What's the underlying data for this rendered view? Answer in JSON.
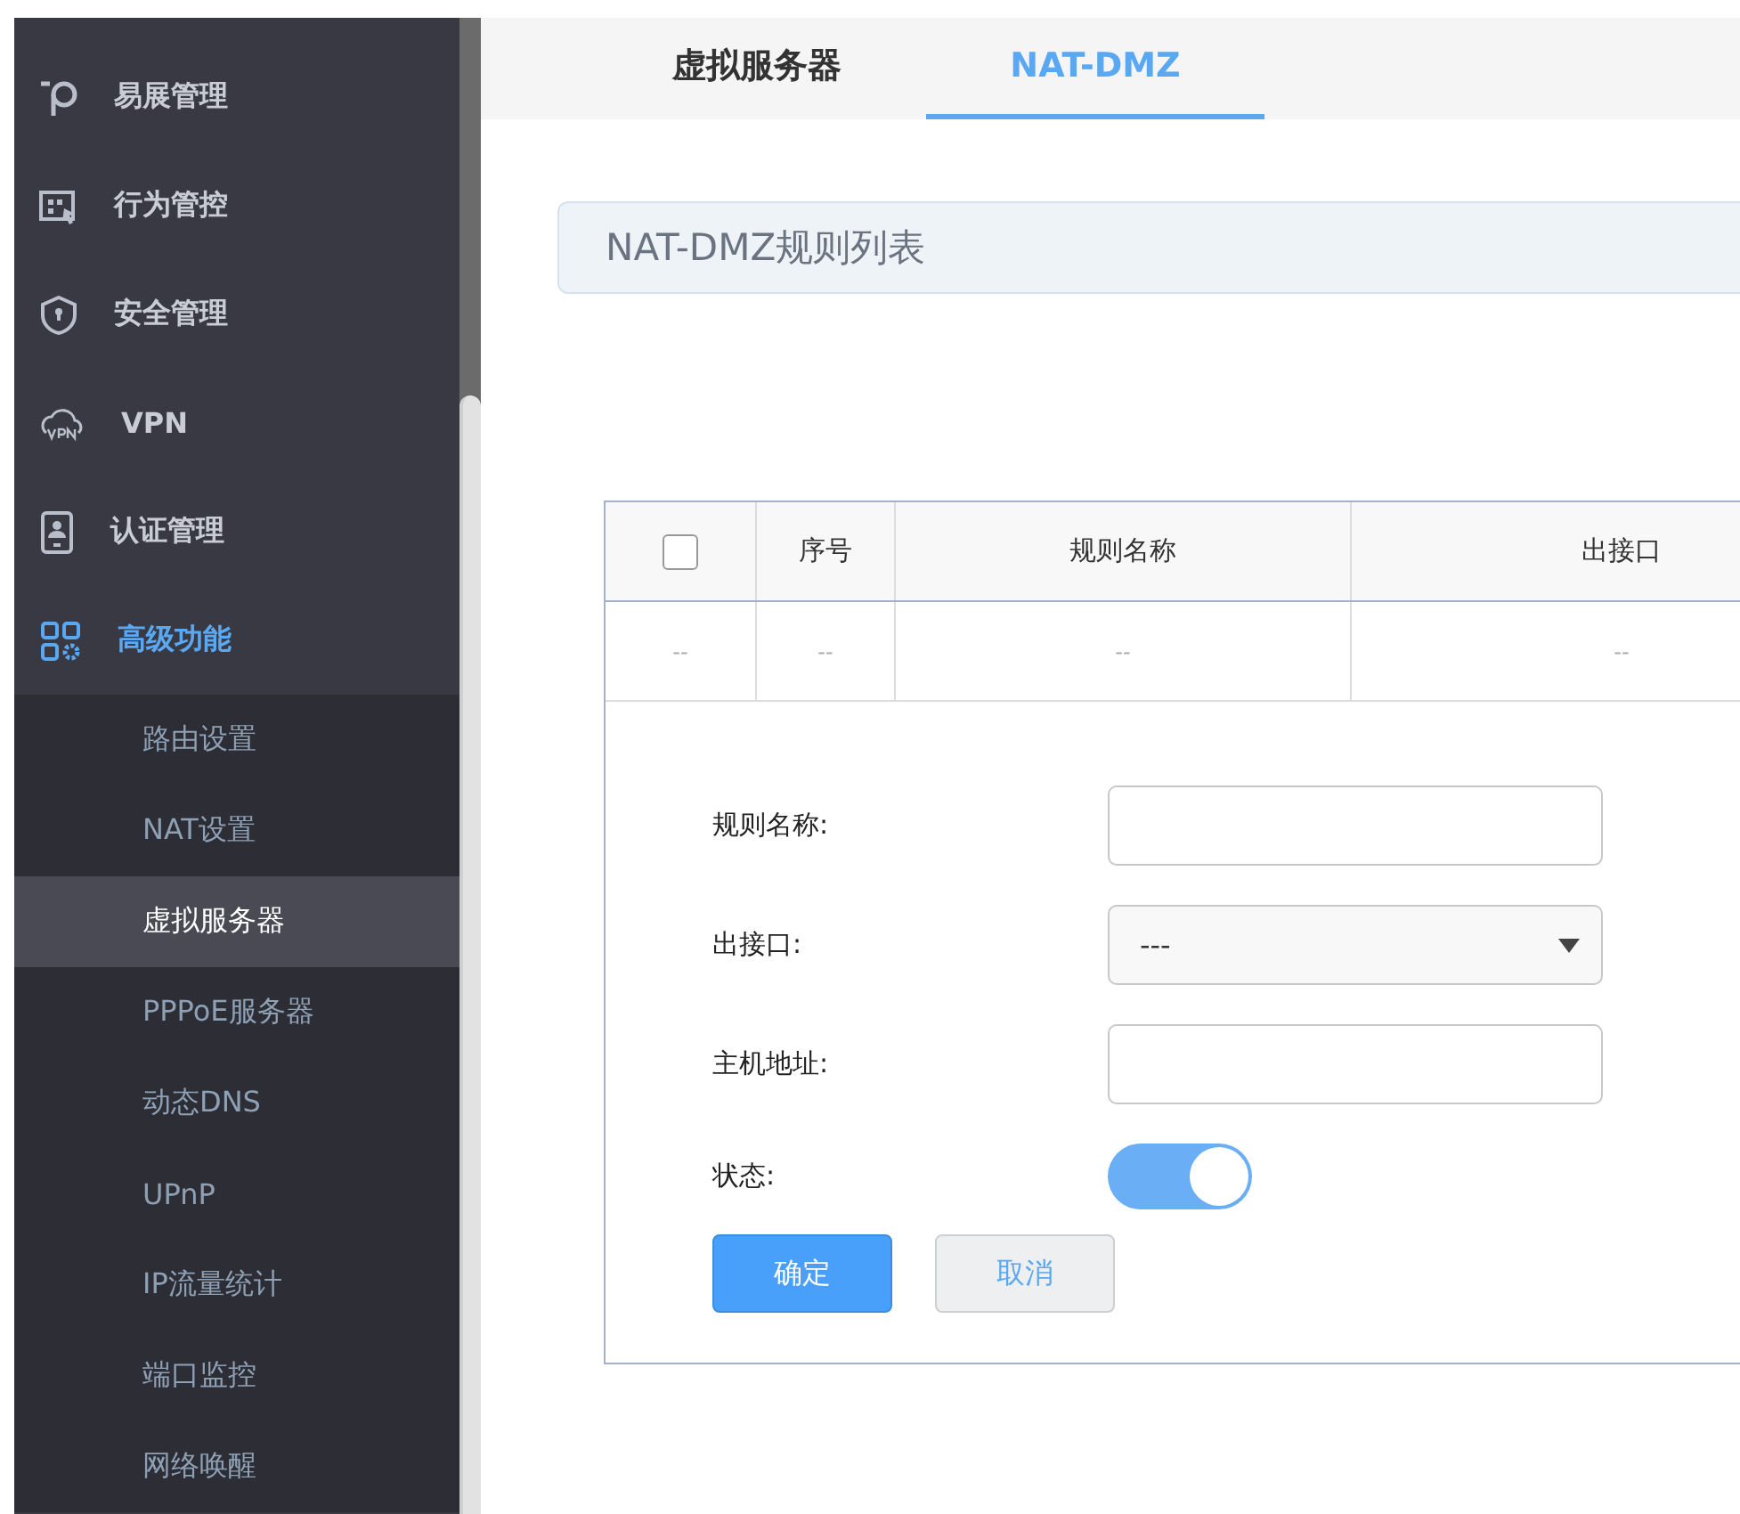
{
  "sidebar": {
    "items": [
      {
        "label": "易展管理",
        "selected": false
      },
      {
        "label": "行为管控",
        "selected": false
      },
      {
        "label": "安全管理",
        "selected": false
      },
      {
        "label": "VPN",
        "selected": false
      },
      {
        "label": "认证管理",
        "selected": false
      },
      {
        "label": "高级功能",
        "selected": true,
        "expanded": true,
        "children": [
          {
            "label": "路由设置",
            "selected": false
          },
          {
            "label": "NAT设置",
            "selected": false
          },
          {
            "label": "虚拟服务器",
            "selected": true
          },
          {
            "label": "PPPoE服务器",
            "selected": false
          },
          {
            "label": "动态DNS",
            "selected": false
          },
          {
            "label": "UPnP",
            "selected": false
          },
          {
            "label": "IP流量统计",
            "selected": false
          },
          {
            "label": "端口监控",
            "selected": false
          },
          {
            "label": "网络唤醒",
            "selected": false
          }
        ]
      }
    ]
  },
  "tabs": [
    {
      "label": "虚拟服务器",
      "selected": false
    },
    {
      "label": "NAT-DMZ",
      "selected": true
    }
  ],
  "section_title": "NAT-DMZ规则列表",
  "table": {
    "columns": [
      {
        "kind": "checkbox",
        "checked": false
      },
      {
        "kind": "text",
        "label": "序号"
      },
      {
        "kind": "text",
        "label": "规则名称"
      },
      {
        "kind": "text",
        "label": "出接口"
      }
    ],
    "rows": [
      [
        "--",
        "--",
        "--",
        "--"
      ]
    ]
  },
  "form": {
    "fields": [
      {
        "kind": "text",
        "label": "规则名称:"
      },
      {
        "kind": "select",
        "label": "出接口:",
        "value": "---"
      },
      {
        "kind": "text",
        "label": "主机地址:"
      },
      {
        "kind": "switch",
        "label": "状态:",
        "on": true
      }
    ],
    "buttons": [
      {
        "label": "确定",
        "kind": "primary"
      },
      {
        "label": "取消",
        "kind": "secondary"
      }
    ]
  }
}
